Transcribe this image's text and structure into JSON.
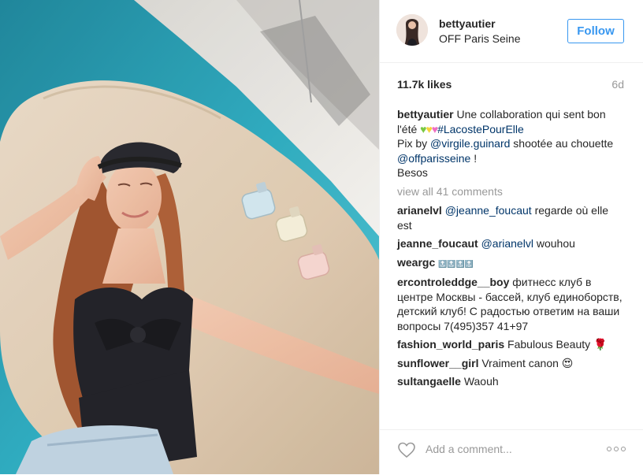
{
  "post": {
    "username": "bettyautier",
    "location": "OFF Paris Seine",
    "follow_label": "Follow",
    "likes": "11.7k likes",
    "time_ago": "6d",
    "view_all_comments": "view all 41 comments",
    "add_comment_placeholder": "Add a comment...",
    "caption": {
      "author": "bettyautier",
      "text_1": "Une collaboration qui sent bon l'été",
      "hashtag": "#LacostePourElle",
      "text_2": "Pix by",
      "mention_1": "@virgile.guinard",
      "text_3": "shootée au chouette",
      "mention_2": "@offparisseine",
      "text_4": "!",
      "text_5": "Besos"
    }
  },
  "comments": [
    {
      "author": "arianelvl",
      "mention": "@jeanne_foucaut",
      "text": "regarde où elle est"
    },
    {
      "author": "jeanne_foucaut",
      "mention": "@arianelvl",
      "text": "wouhou"
    },
    {
      "author": "weargc",
      "text": "🔝🔝🔝🔝"
    },
    {
      "author": "ercontroleddge__boy",
      "text": "фитнесс клуб в центре Москвы - бассей, клуб единоборств, детский клуб! С радостью ответим на ваши вопросы 7(495)357 41+97"
    },
    {
      "author": "fashion_world_paris",
      "text": "Fabulous Beauty",
      "emoji": "🌹"
    },
    {
      "author": "sunflower__girl",
      "text": "Vraiment canon",
      "emoji": "😍"
    },
    {
      "author": "sultangaelle",
      "text": "Waouh"
    }
  ],
  "icons": {
    "like": "heart-outline-icon",
    "more": "more-options-icon"
  },
  "colors": {
    "accent": "#3897f0",
    "link": "#003569",
    "muted": "#999999",
    "text": "#262626"
  }
}
